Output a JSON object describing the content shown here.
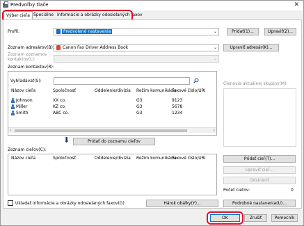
{
  "window": {
    "title": "Predvoľby tlače"
  },
  "tabs": [
    {
      "label": "Výber cieľa"
    },
    {
      "label": "Špeciálne"
    },
    {
      "label": "Informácie a obrázky odosielaných faxov"
    }
  ],
  "profile": {
    "label": "Profil:",
    "value": "Predvolené nastavenia",
    "add_btn": "Pridať(1)...",
    "edit_btn": "Upraviť(2)..."
  },
  "address_book": {
    "label": "Zoznam adresárov(B):",
    "value": "Canon Fax Driver Address Book",
    "edit_btn": "Upraviť adresár(K)..."
  },
  "address_sub": {
    "label": "Zoznam zoznamov kontaktov(L):"
  },
  "contacts": {
    "label": "Zoznam kontaktov(R):"
  },
  "search": {
    "label": "Vyhľadávať(S):",
    "value": ""
  },
  "group_members": {
    "label": "Členovia aktuálnej skupiny(M):"
  },
  "contacts_table": {
    "columns": [
      "Názov cieľa",
      "Spoločnosť",
      "Oddelenie/divízia",
      "Režim komunikácie",
      "Faxové číslo/URI"
    ],
    "rows": [
      [
        "Johnson",
        "XX co.",
        "",
        "G3",
        "9123"
      ],
      [
        "Miller",
        "KZ co.",
        "",
        "G3",
        "5678"
      ],
      [
        "Smith",
        "ABC co.",
        "",
        "G3",
        "1234"
      ]
    ]
  },
  "add_to_list_btn": "Pridať do zoznamu cieľov",
  "target_list": {
    "label": "Zoznam cieľov(C):"
  },
  "target_table": {
    "columns": [
      "Názov cieľa",
      "Spoločnosť",
      "Oddelenie/divízia",
      "Režim komunikácie",
      "Faxové číslo/URI"
    ]
  },
  "side_buttons": {
    "add": "Pridať cieľ(T)...",
    "edit": "Upraviť cieľ...",
    "remove": "Odstrániť"
  },
  "count": {
    "label": "Počet cieľov:",
    "value": "0"
  },
  "save_info": {
    "label": "Ukladať informácie a obrázky odosielaných faxov(G)"
  },
  "cover_btn": "Hárok obálky(Y)...",
  "detail_btn": "Podrobné nastavenia(U)...",
  "footer": {
    "ok": "OK",
    "cancel": "Zrušiť",
    "help": "Pomocník"
  }
}
